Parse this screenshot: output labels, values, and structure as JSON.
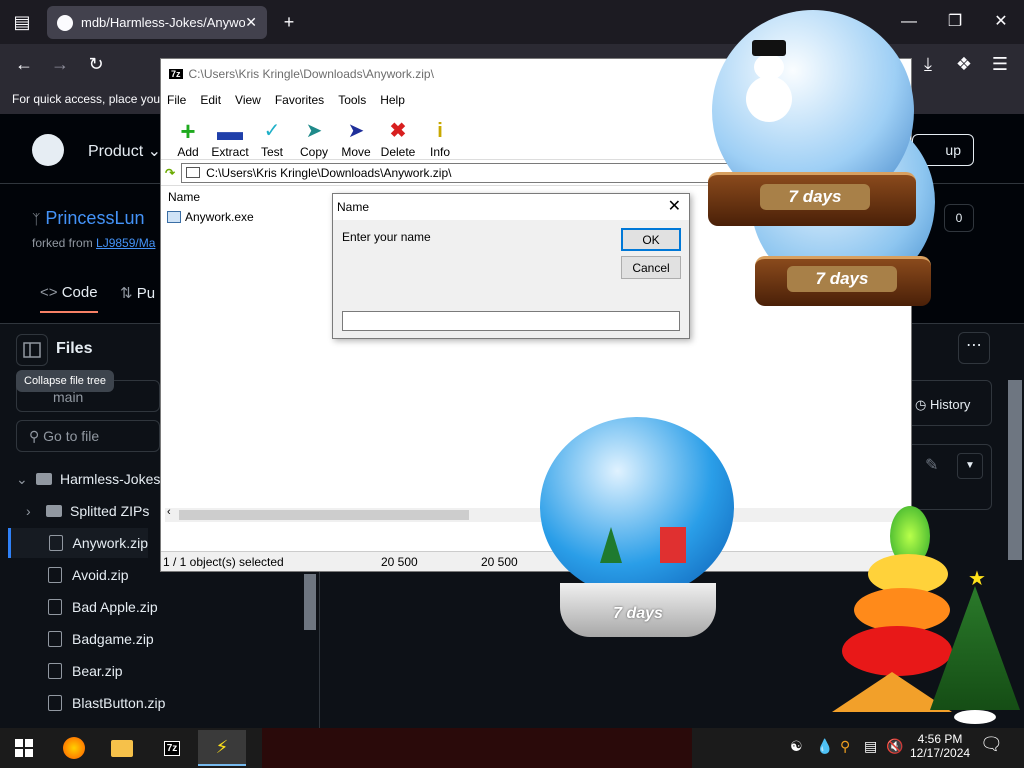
{
  "browser": {
    "tab_title": "mdb/Harmless-Jokes/Anywork",
    "bookmarks_text": "For quick access, place your"
  },
  "github": {
    "nav_product": "Product",
    "sign_up": "up",
    "repo_name": "PrincessLun",
    "forked_from_label": "forked from",
    "forked_from_link": "LJ9859/Ma",
    "tab_code": "Code",
    "tab_pull": "Pu",
    "files_heading": "Files",
    "tooltip": "Collapse file tree",
    "branch": "main",
    "go_to_file_placeholder": "Go to file",
    "history": "History",
    "tree": [
      {
        "label": "Harmless-Jokes",
        "type": "folder-open"
      },
      {
        "label": "Splitted ZIPs",
        "type": "folder"
      },
      {
        "label": "Anywork.zip",
        "type": "file",
        "selected": true
      },
      {
        "label": "Avoid.zip",
        "type": "file"
      },
      {
        "label": "Bad Apple.zip",
        "type": "file"
      },
      {
        "label": "Badgame.zip",
        "type": "file"
      },
      {
        "label": "Bear.zip",
        "type": "file"
      },
      {
        "label": "BlastButton.zip",
        "type": "file"
      }
    ]
  },
  "sevenzip": {
    "title": "C:\\Users\\Kris Kringle\\Downloads\\Anywork.zip\\",
    "menu": [
      "File",
      "Edit",
      "View",
      "Favorites",
      "Tools",
      "Help"
    ],
    "tools": [
      {
        "label": "Add",
        "icon": "plus-icon",
        "color": "#1faa1f"
      },
      {
        "label": "Extract",
        "icon": "minus-icon",
        "color": "#1f3faa"
      },
      {
        "label": "Test",
        "icon": "check-icon",
        "color": "#1fb0c8"
      },
      {
        "label": "Copy",
        "icon": "copy-arrow-icon",
        "color": "#1f8a8a"
      },
      {
        "label": "Move",
        "icon": "move-arrow-icon",
        "color": "#1f2f9a"
      },
      {
        "label": "Delete",
        "icon": "x-icon",
        "color": "#d81f1f"
      },
      {
        "label": "Info",
        "icon": "info-icon",
        "color": "#c8a800"
      }
    ],
    "path": "C:\\Users\\Kris Kringle\\Downloads\\Anywork.zip\\",
    "column_name": "Name",
    "file": "Anywork.exe",
    "status_selected": "1 / 1 object(s) selected",
    "status_size1": "20 500",
    "status_size2": "20 500"
  },
  "dialog": {
    "title": "Name",
    "prompt": "Enter your name",
    "ok": "OK",
    "cancel": "Cancel",
    "input_value": ""
  },
  "decorations": {
    "globe1_label": "7 days",
    "globe2_label": "7 days",
    "globe3_label": "7 days"
  },
  "taskbar": {
    "time": "4:56 PM",
    "date": "12/17/2024"
  },
  "colors": {
    "github_link": "#4493f8",
    "dialog_focus": "#0078d7",
    "taskbar_bg": "#1b1b1b"
  }
}
